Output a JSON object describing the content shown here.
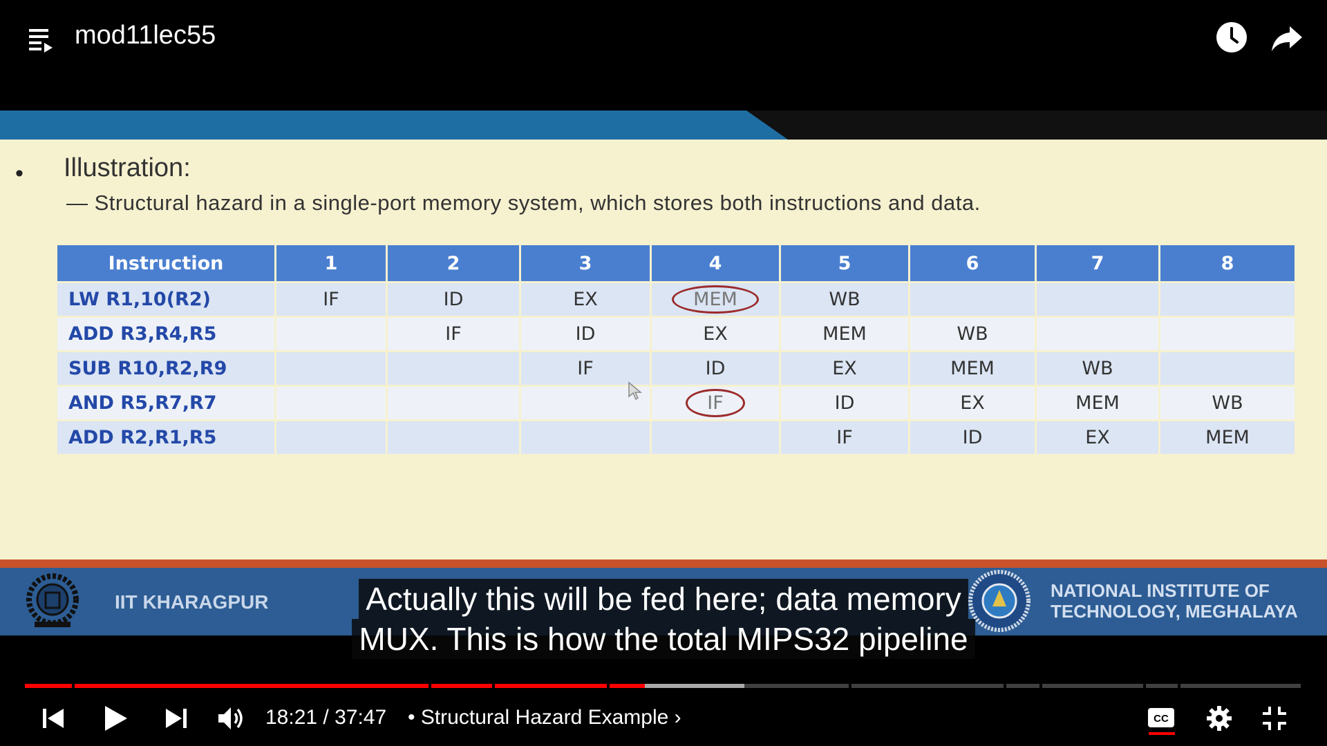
{
  "video": {
    "title": "mod11lec55"
  },
  "slide": {
    "bullet": "•",
    "heading": "Illustration:",
    "subheading": "— Structural hazard in a single-port memory system, which stores both instructions and data.",
    "table": {
      "headers": [
        "Instruction",
        "1",
        "2",
        "3",
        "4",
        "5",
        "6",
        "7",
        "8"
      ],
      "rows": [
        {
          "instr": "LW  R1,10(R2)",
          "cells": [
            "IF",
            "ID",
            "EX",
            "MEM",
            "WB",
            "",
            "",
            ""
          ]
        },
        {
          "instr": "ADD  R3,R4,R5",
          "cells": [
            "",
            "IF",
            "ID",
            "EX",
            "MEM",
            "WB",
            "",
            ""
          ]
        },
        {
          "instr": "SUB  R10,R2,R9",
          "cells": [
            "",
            "",
            "IF",
            "ID",
            "EX",
            "MEM",
            "WB",
            ""
          ]
        },
        {
          "instr": "AND  R5,R7,R7",
          "cells": [
            "",
            "",
            "",
            "IF",
            "ID",
            "EX",
            "MEM",
            "WB"
          ]
        },
        {
          "instr": "ADD  R2,R1,R5",
          "cells": [
            "",
            "",
            "",
            "",
            "IF",
            "ID",
            "EX",
            "MEM"
          ]
        }
      ]
    },
    "footer_left": "IIT KHARAGPUR",
    "footer_right_line1": "NATIONAL INSTITUTE OF",
    "footer_right_line2": "TECHNOLOGY, MEGHALAYA",
    "colors": {
      "banner": "#1f6ea3",
      "header": "#4a7fd0",
      "footer": "#2d5d94",
      "circle": "#9b2b2b"
    }
  },
  "captions": {
    "line1": "Actually this will be fed here; data memory",
    "line2": "MUX. This is how the total MIPS32 pipeline"
  },
  "player": {
    "current_time": "18:21",
    "separator": " / ",
    "duration": "37:47",
    "chapter": "• Structural Hazard Example",
    "chapter_chevron": "›",
    "progress_fraction": 0.486,
    "buffered_fraction": 0.564,
    "icons": [
      "playlist-icon",
      "clock-icon",
      "share-icon",
      "previous-icon",
      "play-icon",
      "next-icon",
      "volume-icon",
      "captions-icon",
      "settings-gear-icon",
      "exit-fullscreen-icon"
    ]
  }
}
